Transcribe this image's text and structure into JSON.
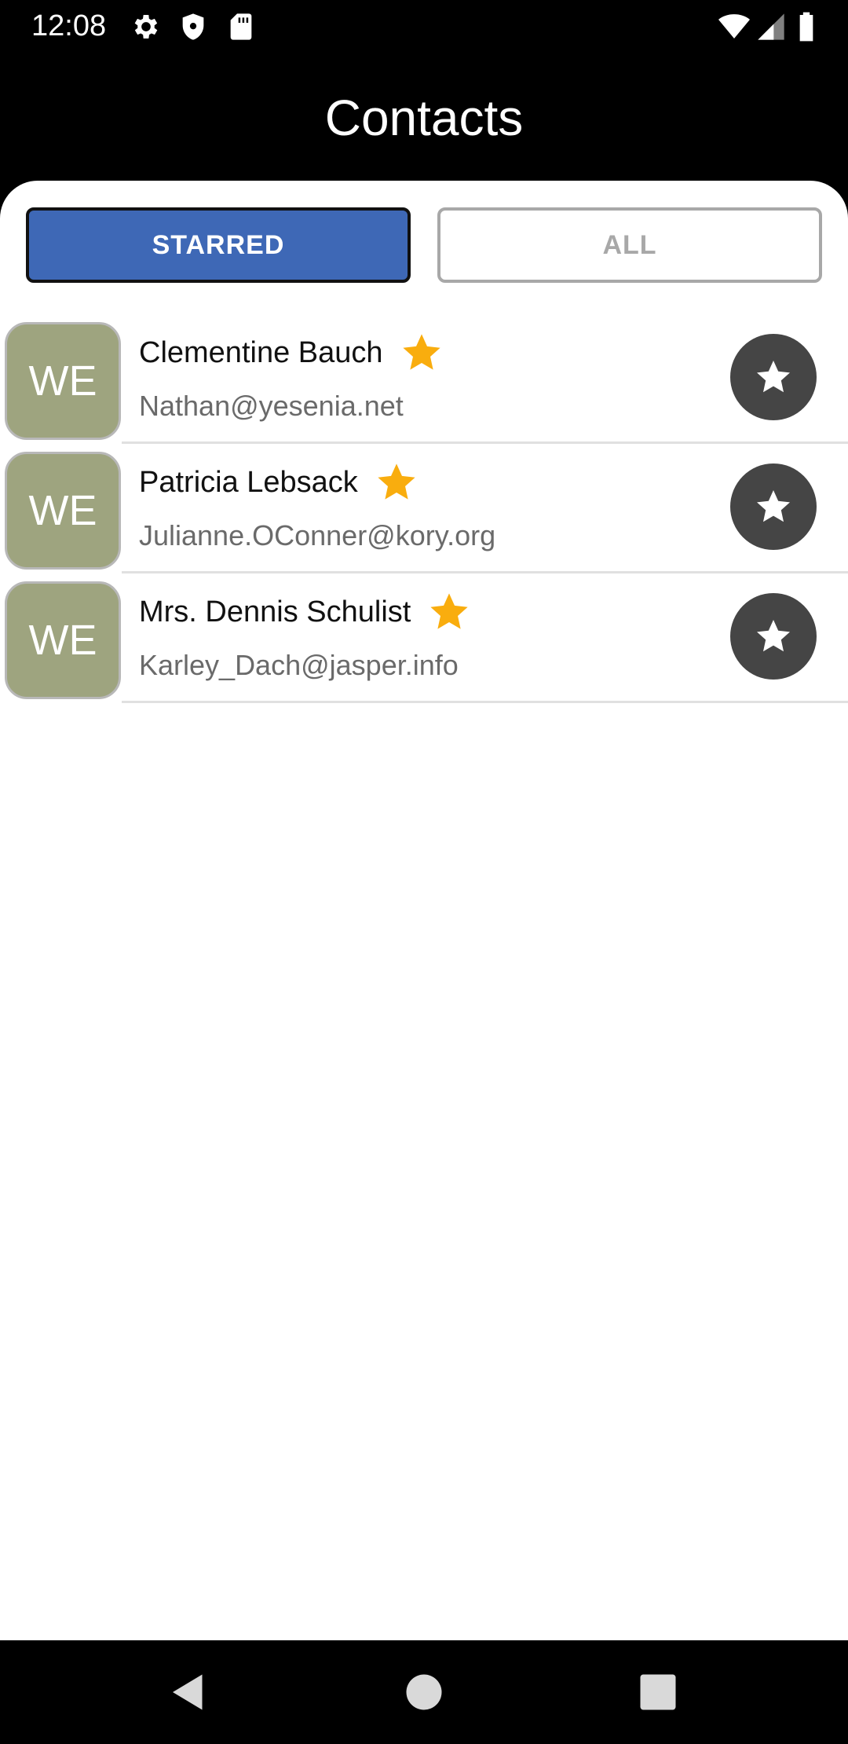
{
  "status_bar": {
    "time": "12:08",
    "left_icons": [
      "gear-icon",
      "shield-icon",
      "sd-card-icon"
    ],
    "right_icons": [
      "wifi-icon",
      "cell-signal-icon",
      "battery-icon"
    ]
  },
  "header": {
    "title": "Contacts"
  },
  "filter_tabs": {
    "starred_label": "STARRED",
    "all_label": "ALL",
    "selected": "STARRED"
  },
  "contacts": [
    {
      "initials": "WE",
      "name": "Clementine Bauch",
      "email": "Nathan@yesenia.net",
      "starred": true
    },
    {
      "initials": "WE",
      "name": "Patricia Lebsack",
      "email": "Julianne.OConner@kory.org",
      "starred": true
    },
    {
      "initials": "WE",
      "name": "Mrs. Dennis Schulist",
      "email": "Karley_Dach@jasper.info",
      "starred": true
    }
  ],
  "colors": {
    "selected_tab": "#3e68b6",
    "avatar_bg": "#9ea47f",
    "star_gold": "#f9ad0e",
    "star_button_bg": "#454545"
  },
  "nav_bar": {
    "icons": [
      "back-icon",
      "home-icon",
      "recents-icon"
    ]
  }
}
